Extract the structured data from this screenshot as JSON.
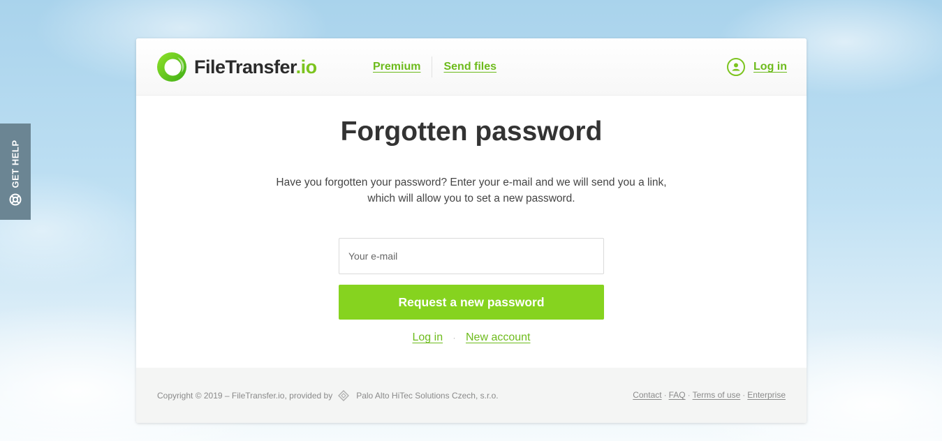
{
  "help_tab": {
    "label": "GET HELP",
    "icon": "lifebuoy-icon"
  },
  "header": {
    "logo": {
      "name": "FileTransfer",
      "tld": ".io",
      "icon": "logo-ring-icon"
    },
    "nav": [
      {
        "label": "Premium"
      },
      {
        "label": "Send files"
      }
    ],
    "login": {
      "label": "Log in",
      "icon": "user-circle-icon"
    }
  },
  "main": {
    "title": "Forgotten password",
    "intro_line1": "Have you forgotten your password? Enter your e-mail and we will send you a link,",
    "intro_line2": "which will allow you to set a new password.",
    "email": {
      "placeholder": "Your e-mail",
      "value": ""
    },
    "submit_label": "Request a new password",
    "links": {
      "login": "Log in",
      "separator": "·",
      "new_account": "New account"
    }
  },
  "footer": {
    "copyright_text": "Copyright © 2019 – FileTransfer.io, provided by",
    "provider": "Palo Alto HiTec Solutions Czech, s.r.o.",
    "provider_icon": "diamond-logo-icon",
    "links": [
      "Contact",
      "FAQ",
      "Terms of use",
      "Enterprise"
    ],
    "link_separator": "·"
  },
  "colors": {
    "accent": "#86d31f",
    "link": "#6dbb1c",
    "help_tab": "#6b8593",
    "title": "#333333"
  }
}
